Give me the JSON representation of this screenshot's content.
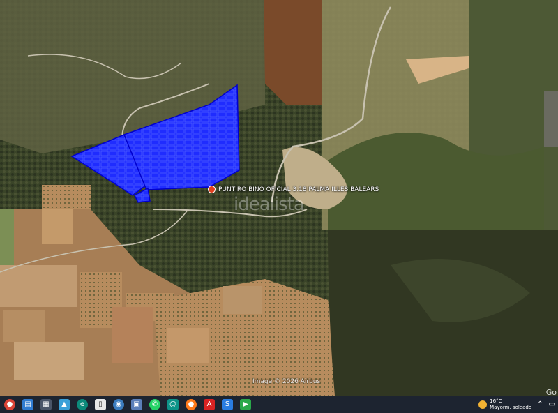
{
  "map": {
    "place_label": "PUNTIRO BINO OFICIAL 3.18 PALMA ILLES BALEARS",
    "watermark": "idealista",
    "imagery_credit": "Image © 2026 Airbus",
    "corner_logo": "Go",
    "colors": {
      "parcel_fill": "#1f2cff",
      "parcel_stroke": "#0000cc",
      "forest": "#2f3a22",
      "farmland": "#a87f55"
    }
  },
  "taskbar": {
    "icons": [
      "chrome-icon",
      "app-icon",
      "app-icon",
      "app-icon",
      "edge-icon",
      "file-icon",
      "app-icon",
      "photos-icon",
      "whatsapp-icon",
      "app-icon",
      "firefox-icon",
      "acrobat-icon",
      "app-icon",
      "app-icon"
    ],
    "weather_temp": "16°C",
    "weather_desc": "Mayorm. soleado"
  }
}
